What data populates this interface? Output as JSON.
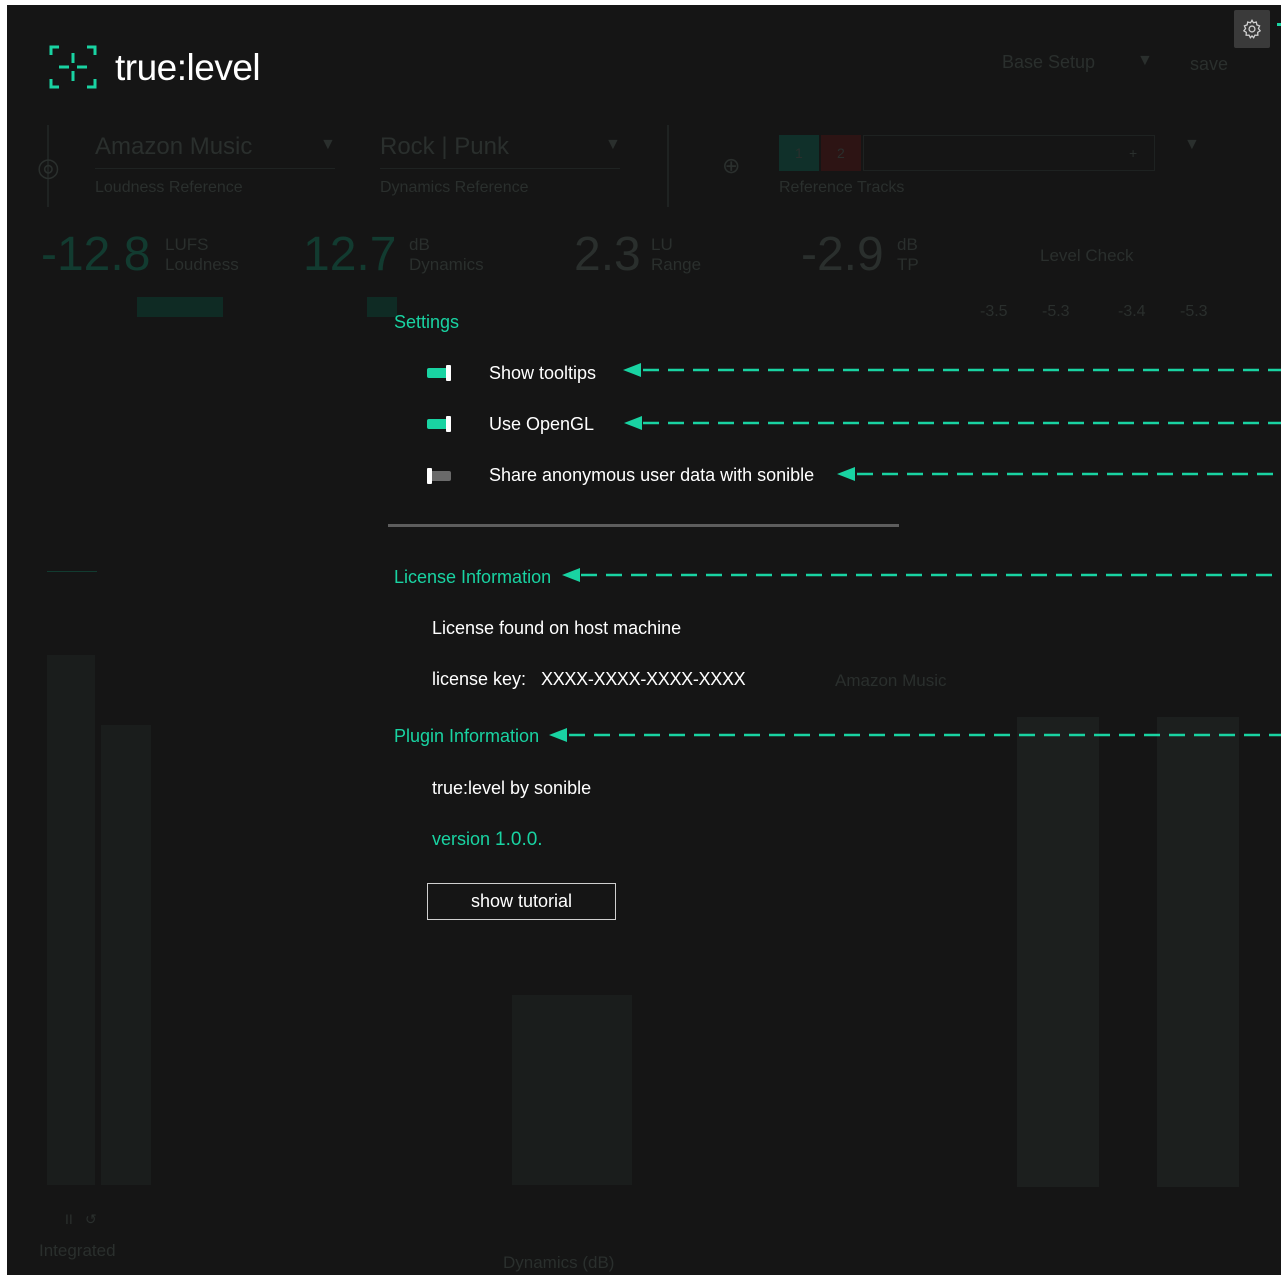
{
  "app": {
    "logo_text": "true:level",
    "icons": {
      "logo": "crosshair-logo-icon",
      "gear": "gear-icon"
    },
    "accent_color": "#19d3a2"
  },
  "background": {
    "setup_label": "Base Setup",
    "save_label": "save",
    "loudness_reference": {
      "value": "Amazon Music",
      "label": "Loudness Reference"
    },
    "dynamics_reference": {
      "value": "Rock | Punk",
      "label": "Dynamics Reference"
    },
    "reference_tracks_label": "Reference Tracks",
    "reference_slots": [
      "1",
      "2",
      "+"
    ],
    "meters": [
      {
        "value": "-12.8",
        "unit": "LUFS",
        "label": "Loudness"
      },
      {
        "value": "12.7",
        "unit": "dB",
        "label": "Dynamics"
      },
      {
        "value": "2.3",
        "unit": "LU",
        "label": "Range"
      },
      {
        "value": "-2.9",
        "unit": "dB",
        "label": "TP"
      }
    ],
    "level_check_label": "Level Check",
    "level_check_values": [
      "-3.5",
      "-5.3",
      "-3.4",
      "-5.3"
    ],
    "center_label": "Amazon Music",
    "bottom_label": "Integrated",
    "dynamics_axis_label": "Dynamics (dB)"
  },
  "settings": {
    "title": "Settings",
    "options": [
      {
        "label": "Show tooltips",
        "enabled": true
      },
      {
        "label": "Use OpenGL",
        "enabled": true
      },
      {
        "label": "Share anonymous user data with sonible",
        "enabled": false
      }
    ]
  },
  "license": {
    "title": "License Information",
    "status": "License found on host machine",
    "key_label": "license key:",
    "key_value": "XXXX-XXXX-XXXX-XXXX"
  },
  "plugin": {
    "title": "Plugin Information",
    "name": "true:level by sonible",
    "version_prefix": "version",
    "version_number": "1.0.0.",
    "tutorial_button": "show tutorial"
  }
}
